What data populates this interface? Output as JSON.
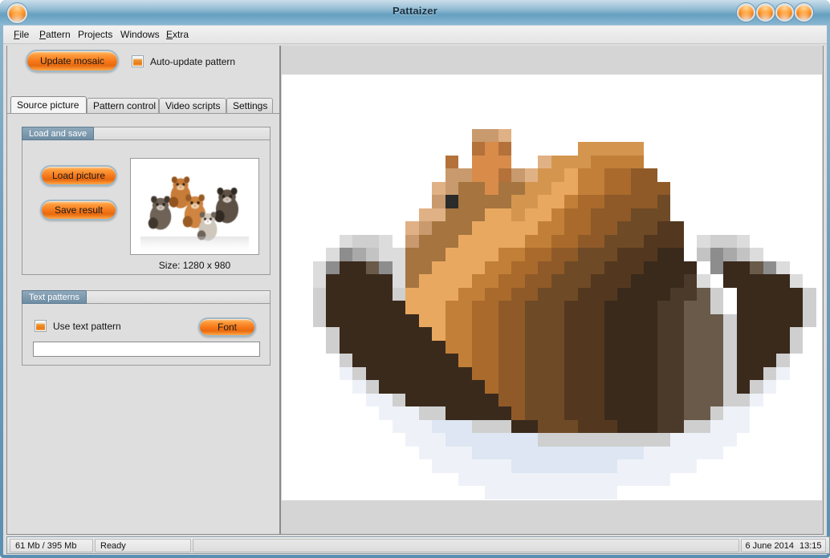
{
  "window": {
    "title": "Pattaizer",
    "app_icon": "app-orb-icon",
    "controls": [
      "minimize-orb",
      "maximize-orb",
      "restore-orb",
      "close-orb"
    ]
  },
  "menubar": {
    "items": [
      {
        "label": "File",
        "mnemonic": "F"
      },
      {
        "label": "Pattern",
        "mnemonic": "P"
      },
      {
        "label": "Projects",
        "mnemonic": ""
      },
      {
        "label": "Windows",
        "mnemonic": ""
      },
      {
        "label": "Extra",
        "mnemonic": "E"
      }
    ]
  },
  "toolbar": {
    "update_button": "Update mosaic",
    "auto_update_label": "Auto-update pattern",
    "auto_update_checked": true
  },
  "tabs": [
    {
      "label": "Source picture",
      "active": true
    },
    {
      "label": "Pattern control",
      "active": false
    },
    {
      "label": "Video scripts",
      "active": false
    },
    {
      "label": "Settings",
      "active": false
    }
  ],
  "load_and_save": {
    "group_title": "Load and save",
    "load_button": "Load picture",
    "save_button": "Save result",
    "size_label": "Size: 1280 x 980"
  },
  "text_patterns": {
    "group_title": "Text patterns",
    "use_text_pattern_label": "Use text pattern",
    "use_text_pattern_checked": true,
    "font_button": "Font",
    "pattern_value": "",
    "pattern_placeholder": ""
  },
  "statusbar": {
    "memory": "61 Mb / 395 Mb",
    "state": "Ready",
    "progress": "",
    "date": "6 June 2014",
    "time": "13:15"
  },
  "colors": {
    "accent_orange": "#f5781a",
    "title_blue": "#7eaecb",
    "panel_gray": "#dedede",
    "group_header": "#7e99ad"
  },
  "preview": {
    "name": "mosaic-preview-canvas",
    "block_size_px": 16.5,
    "grid_cols": 40,
    "grid_rows": 31,
    "pixels": [
      "........................................",
      "........................................",
      "........................................",
      ".............ccd........................",
      ".............bab.....eeeee..............",
      "...........b.aaa..deeeffff..............",
      "...........ccaabcdeeAffgghh.............",
      "..........dcBBaBBeeAAffgghhh............",
      "..........cCBBBBeeAAfgghhhhi...........",
      ".........ddBBBAAeAAfgghhhiii...........",
      "........dcBBBAAAAAffgghhiiijj..........",
      "...qrrq.cBBBAAAAAffgghhiiijjj.qrrq.....",
      "..qnopqqBBBAAAAffgghhiiijjjkk.pnopq....",
      ".qnkkmnqBBAAAAffgghhiiijjjkkkk.nkkmnq..",
      ".qkkkkkqBAAAAffgghhiiijjjkkkklq.kkkkkq.",
      ".rkkkkkrAAAAffgghhiiijjjkkkkllmr.kkkkkr",
      ".rkkkkkkAAAffgghhiiijjjkkkkllmmr.kkkkkr",
      ".rkkkkkkkAAffgghhiiijjjkkkkllmmmrkkkkkr",
      "..rkkkkkkkAffgghhiiijjjkkkkllmmmrkkkkr.",
      "..rkkkkkkkkffgghhiiijjjkkkkllmmmrkkkkr.",
      "...rkkkkkkkkfgghhiiijjjkkkkllmmmrkkkr..",
      "...srkkkkkkkkgghhiiijjjkkkkllmmmrkkrs..",
      "....srkkkkkkkkghhiiijjjkkkkllmmmrkrs...",
      ".....ssrkkkkkkkhhiiijjjkkkkllmmmrrs....",
      "......sssrrkkkkkhiiijjjkkkkllmmrss.....",
      ".......ssstttrrrkkiiijjjkkkllrrsss.....",
      "........ssstttttttrrrrrrrrrrsssss......",
      ".........sssstttttttttttttssssss.......",
      "..........ssssssttttttttssssss.........",
      "............ssssssssssssssss...........",
      "..............ssssssssss..............."
    ],
    "palette": {
      ".": "#ffffff",
      "a": "#d98c4a",
      "b": "#b4713a",
      "c": "#c89a6e",
      "d": "#e0b184",
      "e": "#d4964f",
      "f": "#c27f38",
      "g": "#a96a2c",
      "h": "#8f5a28",
      "i": "#6f4a26",
      "j": "#53381f",
      "k": "#3a2a1c",
      "l": "#4b3a2a",
      "m": "#6a5a4a",
      "n": "#8d8d8d",
      "o": "#a9a9a9",
      "p": "#c3c3c3",
      "q": "#dcdcdc",
      "r": "#cfcfcf",
      "s": "#eef2f8",
      "t": "#dde6f2",
      "A": "#e9a860",
      "B": "#a5743f",
      "C": "#2b2b2b"
    }
  },
  "thumbnail": {
    "name": "source-thumbnail",
    "grid_cols": 44,
    "grid_rows": 33,
    "background": "#ffffff"
  }
}
